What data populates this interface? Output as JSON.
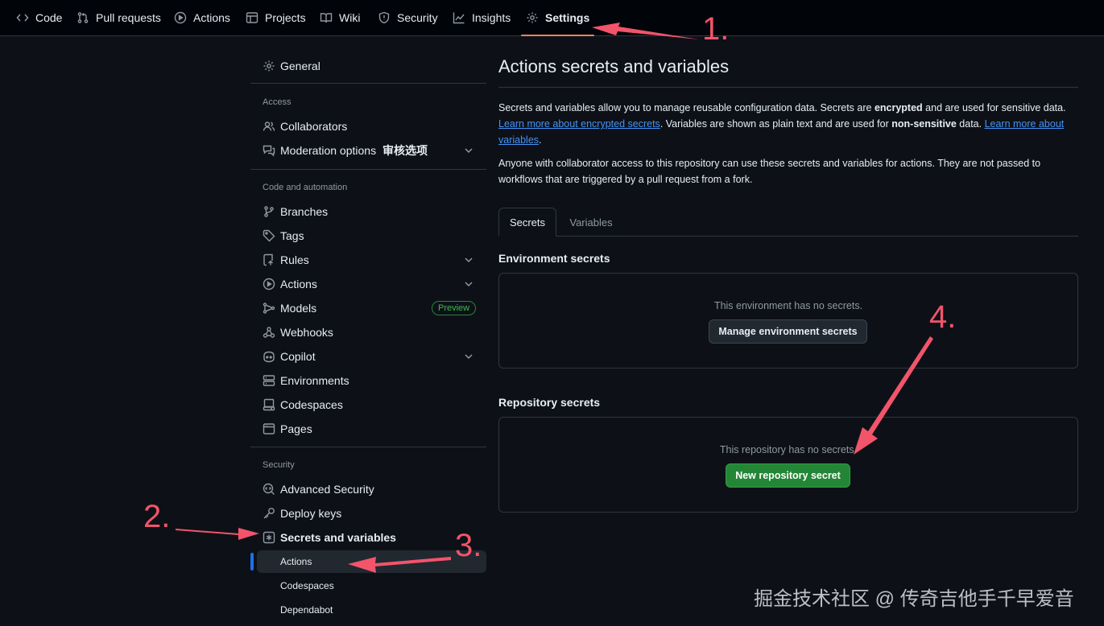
{
  "topnav": {
    "items": [
      {
        "label": "Code",
        "icon": "code-icon"
      },
      {
        "label": "Pull requests",
        "icon": "pull-request-icon"
      },
      {
        "label": "Actions",
        "icon": "play-circle-icon"
      },
      {
        "label": "Projects",
        "icon": "table-icon"
      },
      {
        "label": "Wiki",
        "icon": "book-icon"
      },
      {
        "label": "Security",
        "icon": "shield-icon"
      },
      {
        "label": "Insights",
        "icon": "graph-icon"
      },
      {
        "label": "Settings",
        "icon": "gear-icon",
        "active": true
      }
    ]
  },
  "sidebar": {
    "general": "General",
    "access_heading": "Access",
    "collaborators": "Collaborators",
    "moderation": "Moderation options",
    "moderation_note": "审核选项",
    "code_heading": "Code and automation",
    "branches": "Branches",
    "tags": "Tags",
    "rules": "Rules",
    "actions": "Actions",
    "models": "Models",
    "models_badge": "Preview",
    "webhooks": "Webhooks",
    "copilot": "Copilot",
    "environments": "Environments",
    "codespaces": "Codespaces",
    "pages": "Pages",
    "security_heading": "Security",
    "advanced_security": "Advanced Security",
    "deploy_keys": "Deploy keys",
    "secrets_vars": "Secrets and variables",
    "sub_actions": "Actions",
    "sub_codespaces": "Codespaces",
    "sub_dependabot": "Dependabot"
  },
  "main": {
    "title": "Actions secrets and variables",
    "intro_1": "Secrets and variables allow you to manage reusable configuration data. Secrets are ",
    "intro_bold_1": "encrypted",
    "intro_2": " and are used for sensitive data. ",
    "intro_link_1": "Learn more about encrypted secrets",
    "intro_3": ". Variables are shown as plain text and are used for ",
    "intro_bold_2": "non-sensitive",
    "intro_4": " data. ",
    "intro_link_2": "Learn more about variables",
    "intro_5": ".",
    "access_note": "Anyone with collaborator access to this repository can use these secrets and variables for actions. They are not passed to workflows that are triggered by a pull request from a fork.",
    "tabs": [
      "Secrets",
      "Variables"
    ],
    "env_heading": "Environment secrets",
    "env_empty": "This environment has no secrets.",
    "env_button": "Manage environment secrets",
    "repo_heading": "Repository secrets",
    "repo_empty": "This repository has no secrets.",
    "repo_button": "New repository secret"
  },
  "annotations": {
    "step1": "1.",
    "step2": "2.",
    "step3": "3.",
    "step4": "4.",
    "arrow_color": "#f2546b"
  },
  "watermark": "掘金技术社区 @ 传奇吉他手千早爱音"
}
